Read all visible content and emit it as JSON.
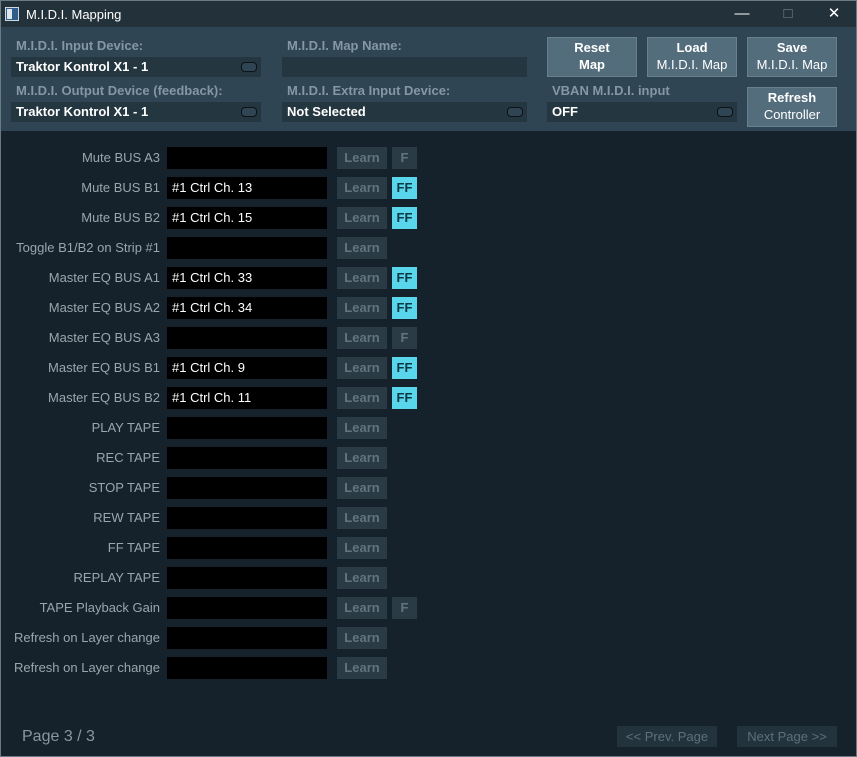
{
  "window": {
    "title": "M.I.D.I. Mapping"
  },
  "header": {
    "input_device_label": "M.I.D.I. Input Device:",
    "input_device_value": "Traktor Kontrol X1 - 1",
    "map_name_label": "M.I.D.I. Map Name:",
    "map_name_value": "",
    "output_device_label": "M.I.D.I. Output Device (feedback):",
    "output_device_value": "Traktor Kontrol X1 - 1",
    "extra_input_label": "M.I.D.I. Extra Input Device:",
    "extra_input_value": "Not Selected",
    "vban_label": "VBAN M.I.D.I. input",
    "vban_value": "OFF",
    "reset_btn": {
      "line1": "Reset",
      "line2": "Map"
    },
    "load_btn": {
      "line1": "Load",
      "line2": "M.I.D.I. Map"
    },
    "save_btn": {
      "line1": "Save",
      "line2": "M.I.D.I. Map"
    },
    "refresh_btn": {
      "line1": "Refresh",
      "line2": "Controller"
    }
  },
  "learn_label": "Learn",
  "rows": [
    {
      "label": "Mute BUS A3",
      "value": "",
      "feedback": "F"
    },
    {
      "label": "Mute BUS B1",
      "value": "#1 Ctrl Ch. 13",
      "feedback": "FF"
    },
    {
      "label": "Mute BUS B2",
      "value": "#1 Ctrl Ch. 15",
      "feedback": "FF"
    },
    {
      "label": "Toggle B1/B2 on Strip #1",
      "value": "",
      "feedback": ""
    },
    {
      "label": "Master EQ BUS A1",
      "value": "#1 Ctrl Ch. 33",
      "feedback": "FF"
    },
    {
      "label": "Master EQ BUS A2",
      "value": "#1 Ctrl Ch. 34",
      "feedback": "FF"
    },
    {
      "label": "Master EQ BUS A3",
      "value": "",
      "feedback": "F"
    },
    {
      "label": "Master EQ BUS B1",
      "value": "#1 Ctrl Ch. 9",
      "feedback": "FF"
    },
    {
      "label": "Master EQ BUS B2",
      "value": "#1 Ctrl Ch. 11",
      "feedback": "FF"
    },
    {
      "label": "PLAY TAPE",
      "value": "",
      "feedback": ""
    },
    {
      "label": "REC TAPE",
      "value": "",
      "feedback": ""
    },
    {
      "label": "STOP TAPE",
      "value": "",
      "feedback": ""
    },
    {
      "label": "REW TAPE",
      "value": "",
      "feedback": ""
    },
    {
      "label": "FF TAPE",
      "value": "",
      "feedback": ""
    },
    {
      "label": "REPLAY TAPE",
      "value": "",
      "feedback": ""
    },
    {
      "label": "TAPE Playback Gain",
      "value": "",
      "feedback": "F"
    },
    {
      "label": "Refresh on Layer change",
      "value": "",
      "feedback": ""
    },
    {
      "label": "Refresh on Layer change",
      "value": "",
      "feedback": ""
    }
  ],
  "footer": {
    "page_indicator": "Page 3 / 3",
    "prev_label": "<< Prev. Page",
    "next_label": "Next Page >>"
  }
}
